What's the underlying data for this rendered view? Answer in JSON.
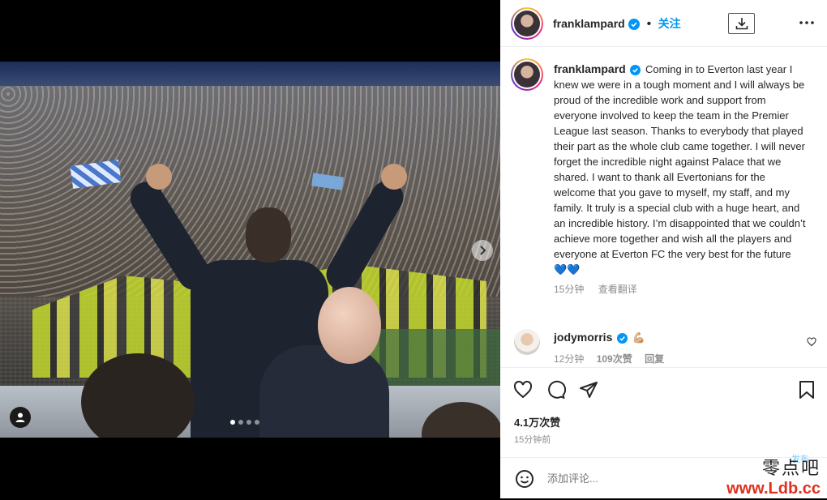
{
  "post": {
    "username": "franklampard",
    "follow_label": "关注",
    "caption": "Coming in to Everton last year I knew we were in a tough moment and I will always be proud of the incredible work and support from everyone involved to keep the team in the Premier League last season. Thanks to everybody that played their part as the whole club came together. I will never forget the incredible night against Palace that we shared. I want to thank all Evertonians for the welcome that you gave to myself, my staff, and my family. It truly is a special club with a huge heart, and an incredible history. I’m disappointed that we couldn’t achieve more together and wish all the players and everyone at Everton FC the very best for the future",
    "caption_emoji": "💙💙",
    "caption_time": "15分钟",
    "see_translation": "查看翻译"
  },
  "comment": {
    "username": "jodymorris",
    "text_emoji": "💪🏼",
    "time": "12分钟",
    "likes": "109次赞",
    "reply": "回复"
  },
  "stats": {
    "likes": "4.1万次赞",
    "time": "15分钟前"
  },
  "comment_bar": {
    "placeholder": "添加评论...",
    "post_label": "发布"
  },
  "watermark": {
    "line1": "零点吧",
    "line2": "www.Ldb.cc"
  },
  "carousel": {
    "total": 4,
    "active_index": 0
  },
  "colors": {
    "accent": "#0095f6",
    "verified": "#0095f6",
    "text": "#262626",
    "muted": "#8e8e8e"
  }
}
